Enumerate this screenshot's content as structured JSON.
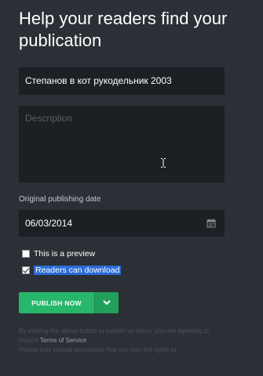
{
  "header": {
    "title": "Help your readers find your publication"
  },
  "form": {
    "title_value": "Степанов в кот рукодельник 2003",
    "description_placeholder": "Description",
    "date_label": "Original publishing date",
    "date_value": "06/03/2014",
    "preview_label": "This is a preview",
    "preview_checked": false,
    "download_label": "Readers can download",
    "download_checked": true
  },
  "actions": {
    "publish_label": "PUBLISH NOW"
  },
  "disclaimer": {
    "line1_prefix": "By clicking the above button to publish on Issuu, you are agreeing to",
    "line2_prefix": "Issuu's ",
    "terms_link": "Terms of Service",
    "line3": "Please only upload documents that you own the rights to."
  },
  "colors": {
    "background": "#2b3036",
    "field_bg": "#1c1f23",
    "publish_green": "#27b66a",
    "selection_blue": "#2a6bd6"
  }
}
